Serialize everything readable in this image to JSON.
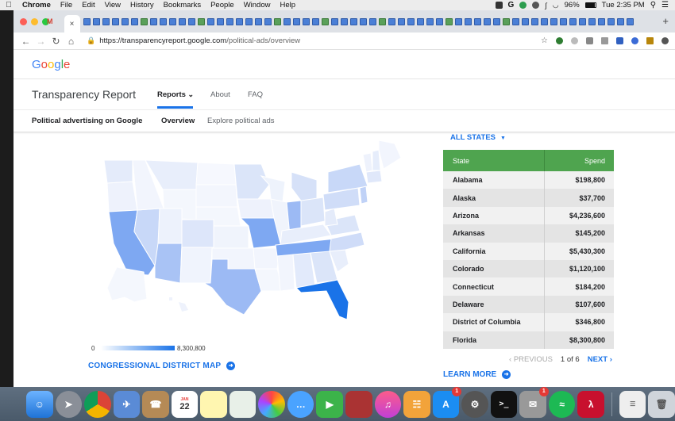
{
  "menubar": {
    "app": "Chrome",
    "items": [
      "File",
      "Edit",
      "View",
      "History",
      "Bookmarks",
      "People",
      "Window",
      "Help"
    ],
    "battery": "96%",
    "clock": "Tue 2:35 PM"
  },
  "browser": {
    "url_host": "https://transparencyreport.google.com",
    "url_path": "/political-ads/overview",
    "tab_close": "×",
    "new_tab": "+"
  },
  "page": {
    "logo": "Google",
    "site_title": "Transparency Report",
    "nav": {
      "reports": "Reports",
      "about": "About",
      "faq": "FAQ"
    },
    "sub_title": "Political advertising on Google",
    "sub_nav": {
      "overview": "Overview",
      "explore": "Explore political ads"
    },
    "filter": "ALL STATES",
    "legend_min": "0",
    "legend_max": "8,300,800",
    "congressional_link": "CONGRESSIONAL DISTRICT MAP",
    "table": {
      "col_state": "State",
      "col_spend": "Spend",
      "rows": [
        {
          "state": "Alabama",
          "spend": "$198,800"
        },
        {
          "state": "Alaska",
          "spend": "$37,700"
        },
        {
          "state": "Arizona",
          "spend": "$4,236,600"
        },
        {
          "state": "Arkansas",
          "spend": "$145,200"
        },
        {
          "state": "California",
          "spend": "$5,430,300"
        },
        {
          "state": "Colorado",
          "spend": "$1,120,100"
        },
        {
          "state": "Connecticut",
          "spend": "$184,200"
        },
        {
          "state": "Delaware",
          "spend": "$107,600"
        },
        {
          "state": "District of Columbia",
          "spend": "$346,800"
        },
        {
          "state": "Florida",
          "spend": "$8,300,800"
        }
      ]
    },
    "pager": {
      "previous": "PREVIOUS",
      "page_info": "1 of 6",
      "next": "NEXT"
    },
    "learn_more": "LEARN MORE"
  },
  "dock": {
    "calendar_day": "22",
    "calendar_month": "JAN",
    "badges": {
      "appstore": "1",
      "mail": "1"
    }
  },
  "colors": {
    "accent": "#1a73e8",
    "table_header": "#4fa44f"
  }
}
